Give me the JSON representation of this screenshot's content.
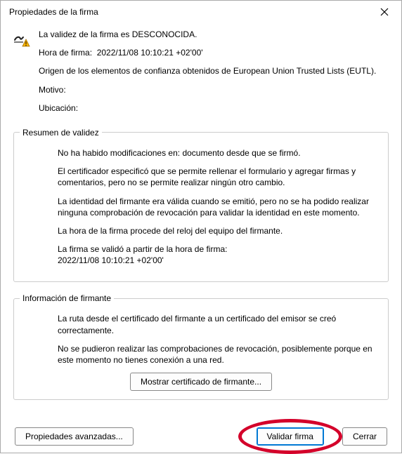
{
  "window": {
    "title": "Propiedades de la firma"
  },
  "top": {
    "validity_line": "La validez de la firma es DESCONOCIDA.",
    "signing_time_label": "Hora de firma:",
    "signing_time_value": "2022/11/08 10:10:21 +02'00'",
    "trust_source": "Origen de los elementos de confianza obtenidos de European Union Trusted Lists (EUTL).",
    "reason_label": "Motivo:",
    "location_label": "Ubicación:"
  },
  "validity_summary": {
    "legend": "Resumen de validez",
    "no_modifications": "No ha habido modificaciones en: documento desde que se firmó.",
    "certifier_permissions": "El certificador especificó que se permite rellenar el formulario y agregar firmas y comentarios, pero no se permite realizar ningún otro cambio.",
    "identity_status": "La identidad del firmante era válida cuando se emitió, pero no se ha podido realizar ninguna comprobación de revocación para validar la identidad en este momento.",
    "clock_source": "La hora de la firma procede del reloj del equipo del firmante.",
    "validated_from_label": "La firma se validó a partir de la hora de firma:",
    "validated_from_value": "2022/11/08 10:10:21 +02'00'"
  },
  "signer_info": {
    "legend": "Información de firmante",
    "path_ok": "La ruta desde el certificado del firmante a un certificado del emisor se creó correctamente.",
    "revocation_fail": "No se pudieron realizar las comprobaciones de revocación, posiblemente porque en este momento no tienes conexión a una red.",
    "show_cert_button": "Mostrar certificado de firmante..."
  },
  "buttons": {
    "advanced": "Propiedades avanzadas...",
    "validate": "Validar firma",
    "close": "Cerrar"
  },
  "icons": {
    "close": "close-icon",
    "signature_warning": "signature-warning-icon"
  },
  "colors": {
    "highlight": "#d4002a",
    "primary_border": "#0078d4",
    "warning_fill": "#f7b500"
  }
}
